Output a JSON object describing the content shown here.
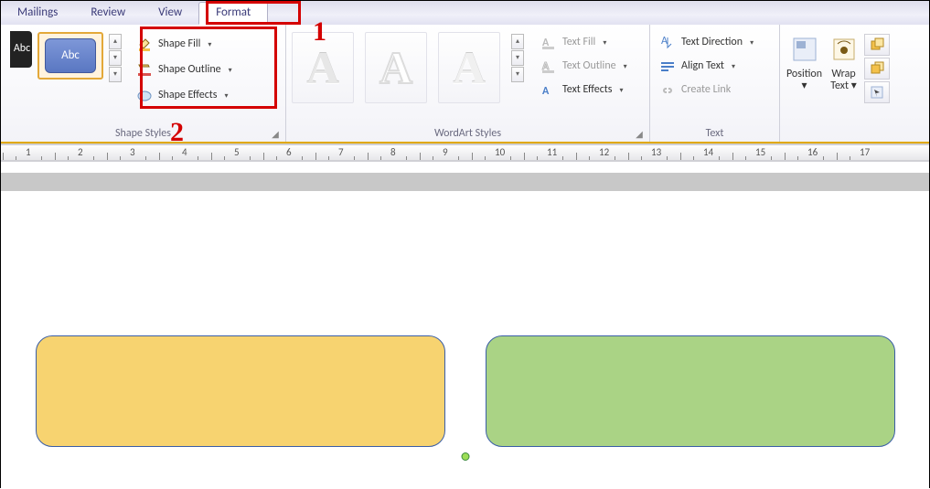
{
  "tabs": {
    "mailings": "Mailings",
    "review": "Review",
    "view": "View",
    "format": "Format"
  },
  "shape_styles": {
    "group_label": "Shape Styles",
    "sample_text": "Abc",
    "fill_label": "Shape Fill",
    "outline_label": "Shape Outline",
    "effects_label": "Shape Effects"
  },
  "wordart": {
    "group_label": "WordArt Styles",
    "sample": "A",
    "text_fill": "Text Fill",
    "text_outline": "Text Outline",
    "text_effects": "Text Effects"
  },
  "textgrp": {
    "group_label": "Text",
    "direction": "Text Direction",
    "align": "Align Text",
    "link": "Create Link"
  },
  "arrange": {
    "position": "Position",
    "wrap": "Wrap Text"
  },
  "annot": {
    "one": "1",
    "two": "2"
  },
  "ruler": {
    "numbers": [
      1,
      2,
      3,
      4,
      5,
      6,
      7,
      8,
      9,
      10,
      11,
      12,
      13,
      14,
      15,
      16,
      17
    ]
  }
}
